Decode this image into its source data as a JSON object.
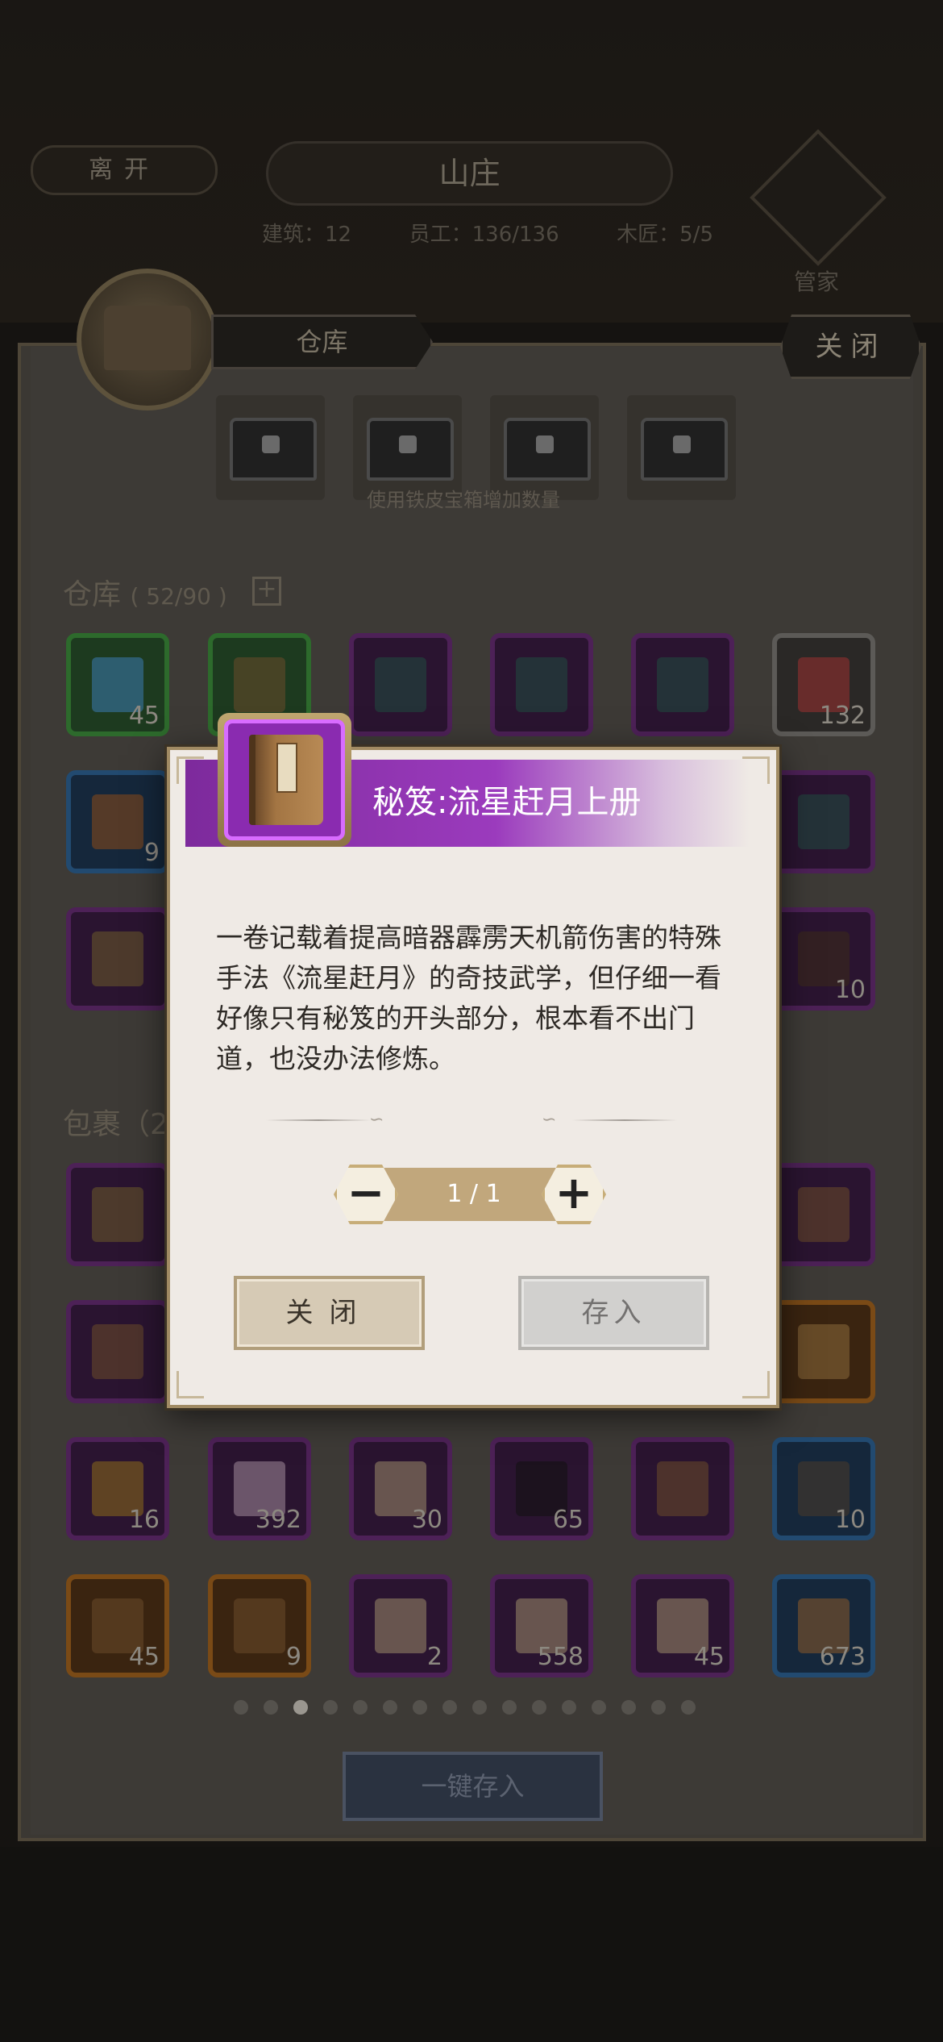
{
  "header": {
    "leave_label": "离开",
    "title": "山庄",
    "stats": {
      "building": "建筑：12",
      "workers": "员工：136/136",
      "carpenter": "木匠：5/5"
    },
    "butler_label": "管家"
  },
  "panel": {
    "tab_label": "仓库",
    "close_label": "关闭",
    "chest_tip": "使用铁皮宝箱增加数量",
    "warehouse_label": "仓库",
    "warehouse_count": "( 52/90 )",
    "bag_label": "包裹（2",
    "deposit_all_label": "一键存入"
  },
  "warehouse_items": [
    {
      "qty": "45"
    },
    {
      "qty": ""
    },
    {
      "qty": ""
    },
    {
      "qty": ""
    },
    {
      "qty": ""
    },
    {
      "qty": "132"
    },
    {
      "qty": "9"
    },
    {
      "qty": ""
    },
    {
      "qty": ""
    },
    {
      "qty": "10"
    }
  ],
  "bag_items": [
    {
      "qty": "16"
    },
    {
      "qty": "392"
    },
    {
      "qty": "30"
    },
    {
      "qty": "65"
    },
    {
      "qty": ""
    },
    {
      "qty": "10"
    },
    {
      "qty": "45"
    },
    {
      "qty": "9"
    },
    {
      "qty": "2"
    },
    {
      "qty": "558"
    },
    {
      "qty": "45"
    },
    {
      "qty": "673"
    }
  ],
  "pagination": {
    "total": 16,
    "current": 3
  },
  "modal": {
    "item_title": "秘笈:流星赶月上册",
    "description": "一卷记载着提高暗器霹雳天机箭伤害的特殊手法《流星赶月》的奇技武学，但仔细一看好像只有秘笈的开头部分，根本看不出门道，也没办法修炼。",
    "quantity_display": "1 / 1",
    "minus_label": "−",
    "plus_label": "+",
    "close_label": "关闭",
    "deposit_label": "存入",
    "rarity_color": "#8a2bb0"
  }
}
